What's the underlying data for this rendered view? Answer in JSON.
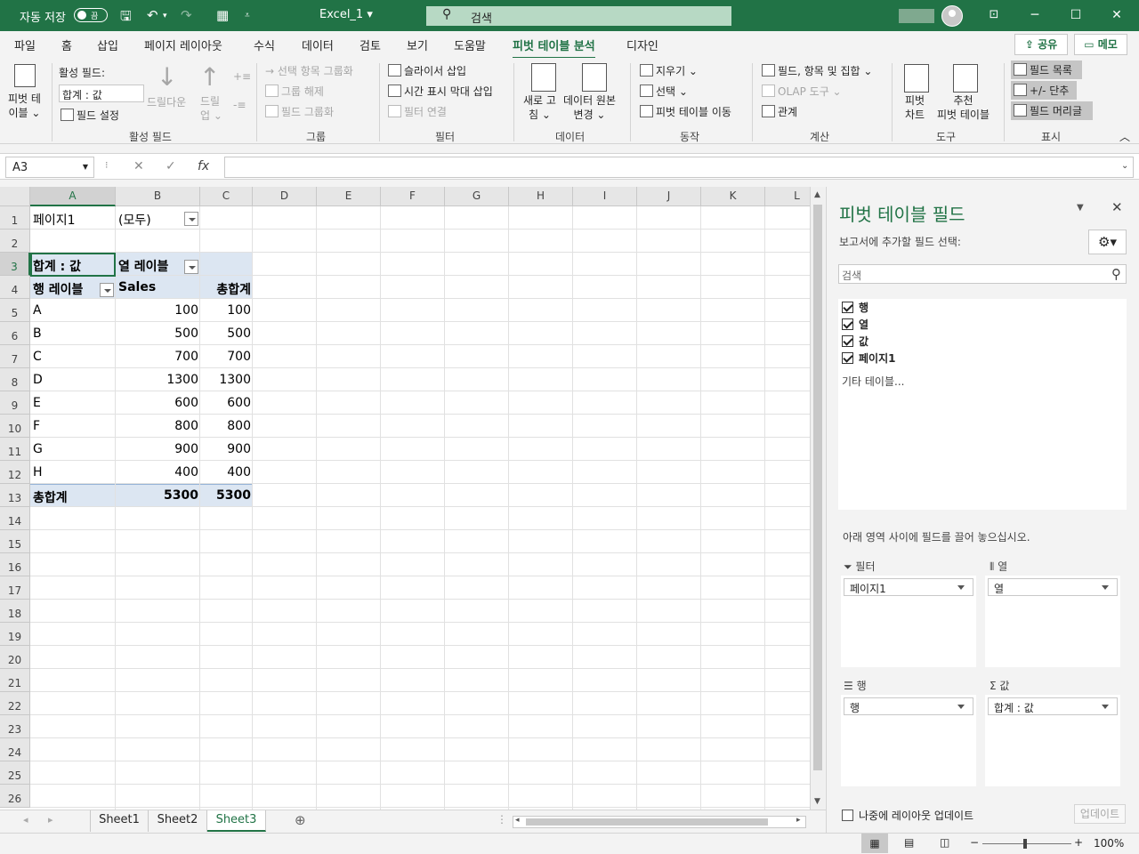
{
  "titlebar": {
    "autosave": "자동 저장",
    "toggle": "끔",
    "title": "Excel_1 ▾",
    "search": "검색"
  },
  "tabs": [
    "파일",
    "홈",
    "삽입",
    "페이지 레이아웃",
    "수식",
    "데이터",
    "검토",
    "보기",
    "도움말",
    "피벗 테이블 분석",
    "디자인"
  ],
  "share": {
    "share": "공유",
    "comment": "메모"
  },
  "ribbon": {
    "pivottable": "피벗 테\n이블 ⌄",
    "active_field_label": "활성 필드:",
    "active_field_value": "합계 : 값",
    "field_settings": "필드 설정",
    "drilldown": "드릴다운",
    "drillup": "드릴\n업 ⌄",
    "grp_active": "활성 필드",
    "group_selection": "선택 항목 그룹화",
    "ungroup": "그룹 해제",
    "group_field": "필드 그룹화",
    "grp_group": "그룹",
    "insert_slicer": "슬라이서 삽입",
    "insert_timeline": "시간 표시 막대 삽입",
    "filter_connections": "필터 연결",
    "grp_filter": "필터",
    "refresh": "새로 고\n침 ⌄",
    "change_source": "데이터 원본\n변경 ⌄",
    "grp_data": "데이터",
    "clear": "지우기 ⌄",
    "select": "선택 ⌄",
    "move_pivot": "피벗 테이블 이동",
    "grp_actions": "동작",
    "fields_items": "필드, 항목 및 집합 ⌄",
    "olap": "OLAP 도구 ⌄",
    "relationships": "관계",
    "grp_calc": "계산",
    "pivotchart": "피벗\n차트",
    "recommended": "추천\n피벗 테이블",
    "grp_tools": "도구",
    "field_list": "필드 목록",
    "buttons": "+/- 단추",
    "field_headers": "필드 머리글",
    "grp_show": "표시"
  },
  "formula": {
    "namebox": "A3",
    "cancel": "✕",
    "enter": "✓",
    "fx": "fx",
    "value": ""
  },
  "columns": [
    "A",
    "B",
    "C",
    "D",
    "E",
    "F",
    "G",
    "H",
    "I",
    "J",
    "K",
    "L"
  ],
  "rows": [
    "1",
    "2",
    "3",
    "4",
    "5",
    "6",
    "7",
    "8",
    "9",
    "10",
    "11",
    "12",
    "13",
    "14",
    "15",
    "16",
    "17",
    "18",
    "19",
    "20",
    "21",
    "22",
    "23",
    "24",
    "25",
    "26"
  ],
  "pivot": {
    "filter_label": "페이지1",
    "filter_value": "(모두)",
    "value_header": "합계 : 값",
    "col_labels": "열 레이블",
    "row_labels": "행 레이블",
    "col_sales": "Sales",
    "col_total": "총합계",
    "data": [
      {
        "label": "A",
        "sales": "100",
        "total": "100"
      },
      {
        "label": "B",
        "sales": "500",
        "total": "500"
      },
      {
        "label": "C",
        "sales": "700",
        "total": "700"
      },
      {
        "label": "D",
        "sales": "1300",
        "total": "1300"
      },
      {
        "label": "E",
        "sales": "600",
        "total": "600"
      },
      {
        "label": "F",
        "sales": "800",
        "total": "800"
      },
      {
        "label": "G",
        "sales": "900",
        "total": "900"
      },
      {
        "label": "H",
        "sales": "400",
        "total": "400"
      }
    ],
    "grand_label": "총합계",
    "grand_sales": "5300",
    "grand_total": "5300"
  },
  "sheets": [
    "Sheet1",
    "Sheet2",
    "Sheet3"
  ],
  "active_sheet": "Sheet3",
  "pane": {
    "title": "피벗 테이블 필드",
    "subtitle": "보고서에 추가할 필드 선택:",
    "search_placeholder": "검색",
    "fields": [
      "행",
      "열",
      "값",
      "페이지1"
    ],
    "more_tables": "기타 테이블...",
    "drag_hint": "아래 영역 사이에 필드를 끌어 놓으십시오.",
    "filters_label": "필터",
    "columns_label": "열",
    "rows_label": "행",
    "values_label": "값",
    "filters_item": "페이지1",
    "columns_item": "열",
    "rows_item": "행",
    "values_item": "합계 : 값",
    "defer": "나중에 레이아웃 업데이트",
    "update": "업데이트"
  },
  "status": {
    "zoom": "100%"
  },
  "colors": {
    "accent": "#217346",
    "pivot_fill": "#dce6f2"
  }
}
